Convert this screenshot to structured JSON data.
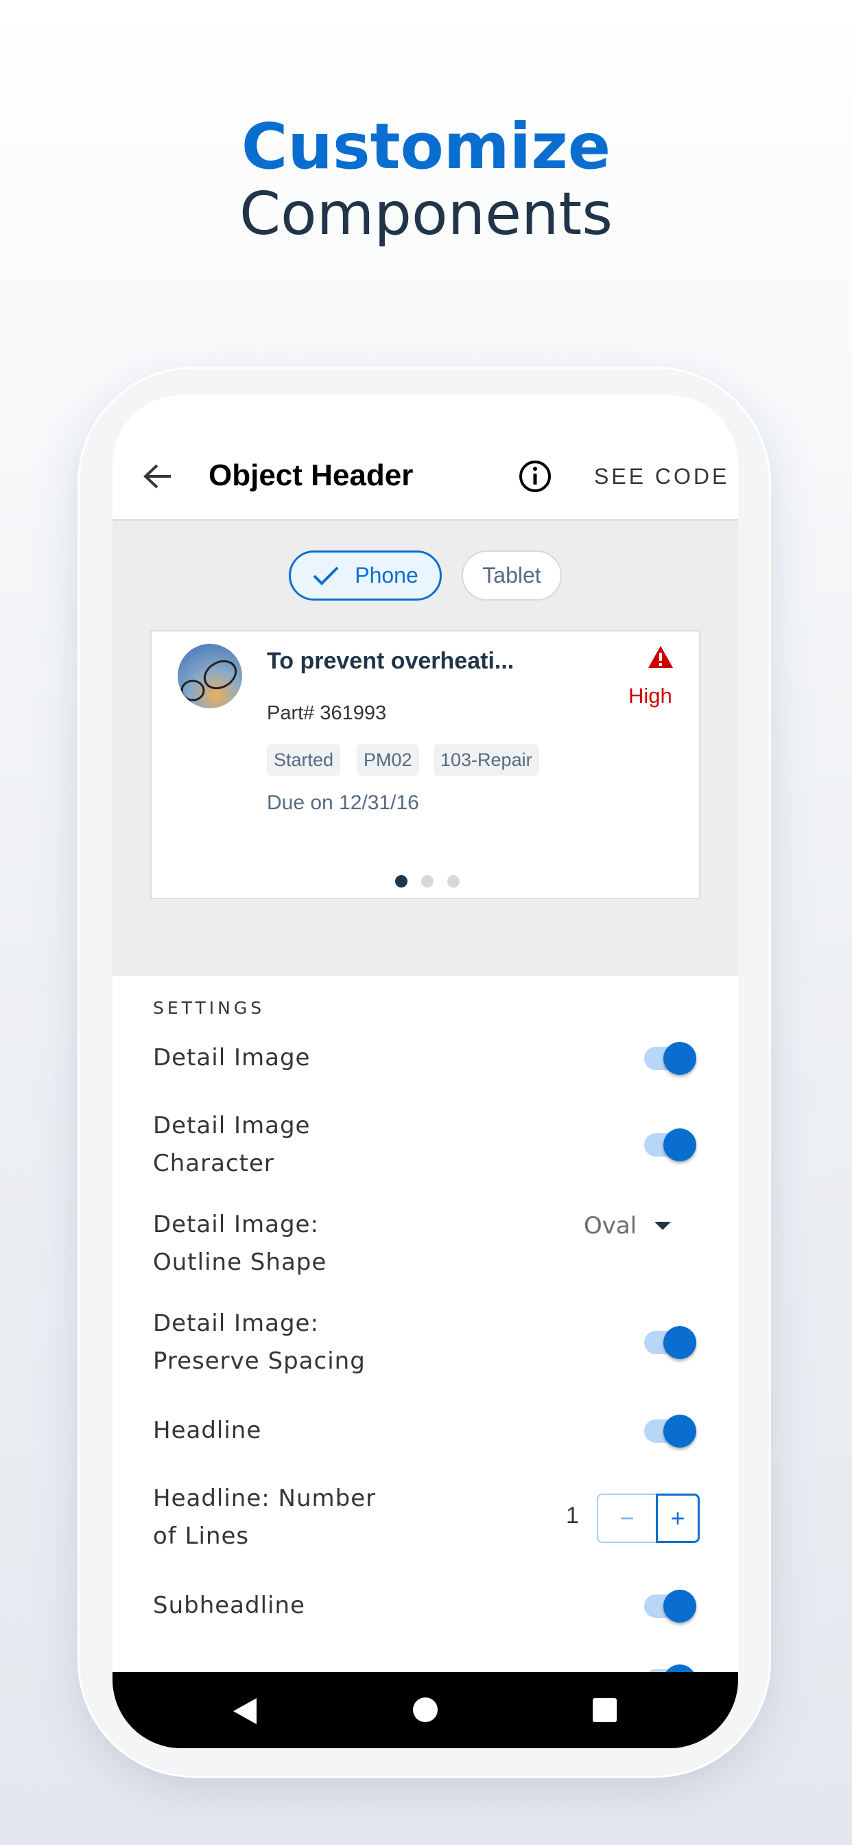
{
  "hero": {
    "title_accent": "Customize",
    "title": "Components"
  },
  "appbar": {
    "title": "Object Header",
    "see_code": "SEE CODE"
  },
  "device_toggle": {
    "phone": "Phone",
    "tablet": "Tablet",
    "selected": "Phone"
  },
  "card": {
    "headline": "To prevent overheati...",
    "subheadline": "Part# 361993",
    "tags": [
      "Started",
      "PM02",
      "103-Repair"
    ],
    "footnote": "Due on 12/31/16",
    "priority": "High",
    "priority_color": "#d00000",
    "page_count": 3,
    "current_page": 1
  },
  "settings": {
    "header": "SETTINGS",
    "detail_image": {
      "label": "Detail Image",
      "on": true
    },
    "detail_image_character": {
      "label_1": "Detail Image",
      "label_2": "Character",
      "on": true
    },
    "outline_shape": {
      "label_1": "Detail Image:",
      "label_2": "Outline Shape",
      "value": "Oval"
    },
    "preserve_spacing": {
      "label_1": "Detail Image:",
      "label_2": "Preserve Spacing",
      "on": true
    },
    "headline": {
      "label": "Headline",
      "on": true
    },
    "headline_lines": {
      "label_1": "Headline: Number",
      "label_2": "of Lines",
      "value": "1",
      "minus": "−",
      "plus": "+"
    },
    "subheadline": {
      "label": "Subheadline",
      "on": true
    }
  },
  "accent": "#0a6ed1"
}
